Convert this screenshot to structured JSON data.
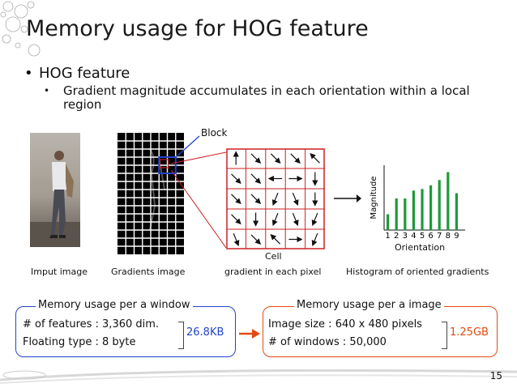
{
  "slide": {
    "title": "Memory usage for HOG feature",
    "bullet_level1": "HOG feature",
    "bullet_level2": "Gradient magnitude accumulates in each orientation within a local region",
    "page_number": "15"
  },
  "figure": {
    "block_label": "Block",
    "cell_label": "Cell",
    "orientation_label": "Orientation",
    "magnitude_label": "Magnitude",
    "captions": {
      "input": "Imput image",
      "gradients": "Gradients image",
      "pixel": "gradient in each pixel",
      "histogram": "Histogram of oriented gradients"
    },
    "cell_arrows": [
      [
        270,
        45,
        45,
        45,
        225
      ],
      [
        45,
        45,
        180,
        0,
        90
      ],
      [
        45,
        45,
        112,
        68,
        90
      ],
      [
        45,
        90,
        112,
        68,
        112
      ],
      [
        68,
        45,
        225,
        0,
        112
      ]
    ]
  },
  "chart_data": {
    "type": "bar",
    "categories": [
      "1",
      "2",
      "3",
      "4",
      "5",
      "6",
      "7",
      "8",
      "9"
    ],
    "values": [
      3,
      6,
      6,
      7.5,
      7.8,
      8.5,
      9.5,
      11,
      7
    ],
    "xlabel": "Orientation",
    "ylabel": "Magnitude",
    "ylim": [
      0,
      12
    ],
    "color": "#1e9a3a"
  },
  "window_box": {
    "title": "Memory usage per a window",
    "line1": "# of features : 3,360 dim.",
    "line2": "Floating type : 8 byte",
    "result": "26.8KB"
  },
  "image_box": {
    "title": "Memory usage per  a image",
    "line1": "Image size : 640 x 480 pixels",
    "line2": "# of windows : 50,000",
    "result": "1.25GB"
  },
  "colors": {
    "blue": "#2244cc",
    "red": "#e24a12",
    "cell_border": "#cc2222",
    "bar": "#1e9a3a"
  }
}
